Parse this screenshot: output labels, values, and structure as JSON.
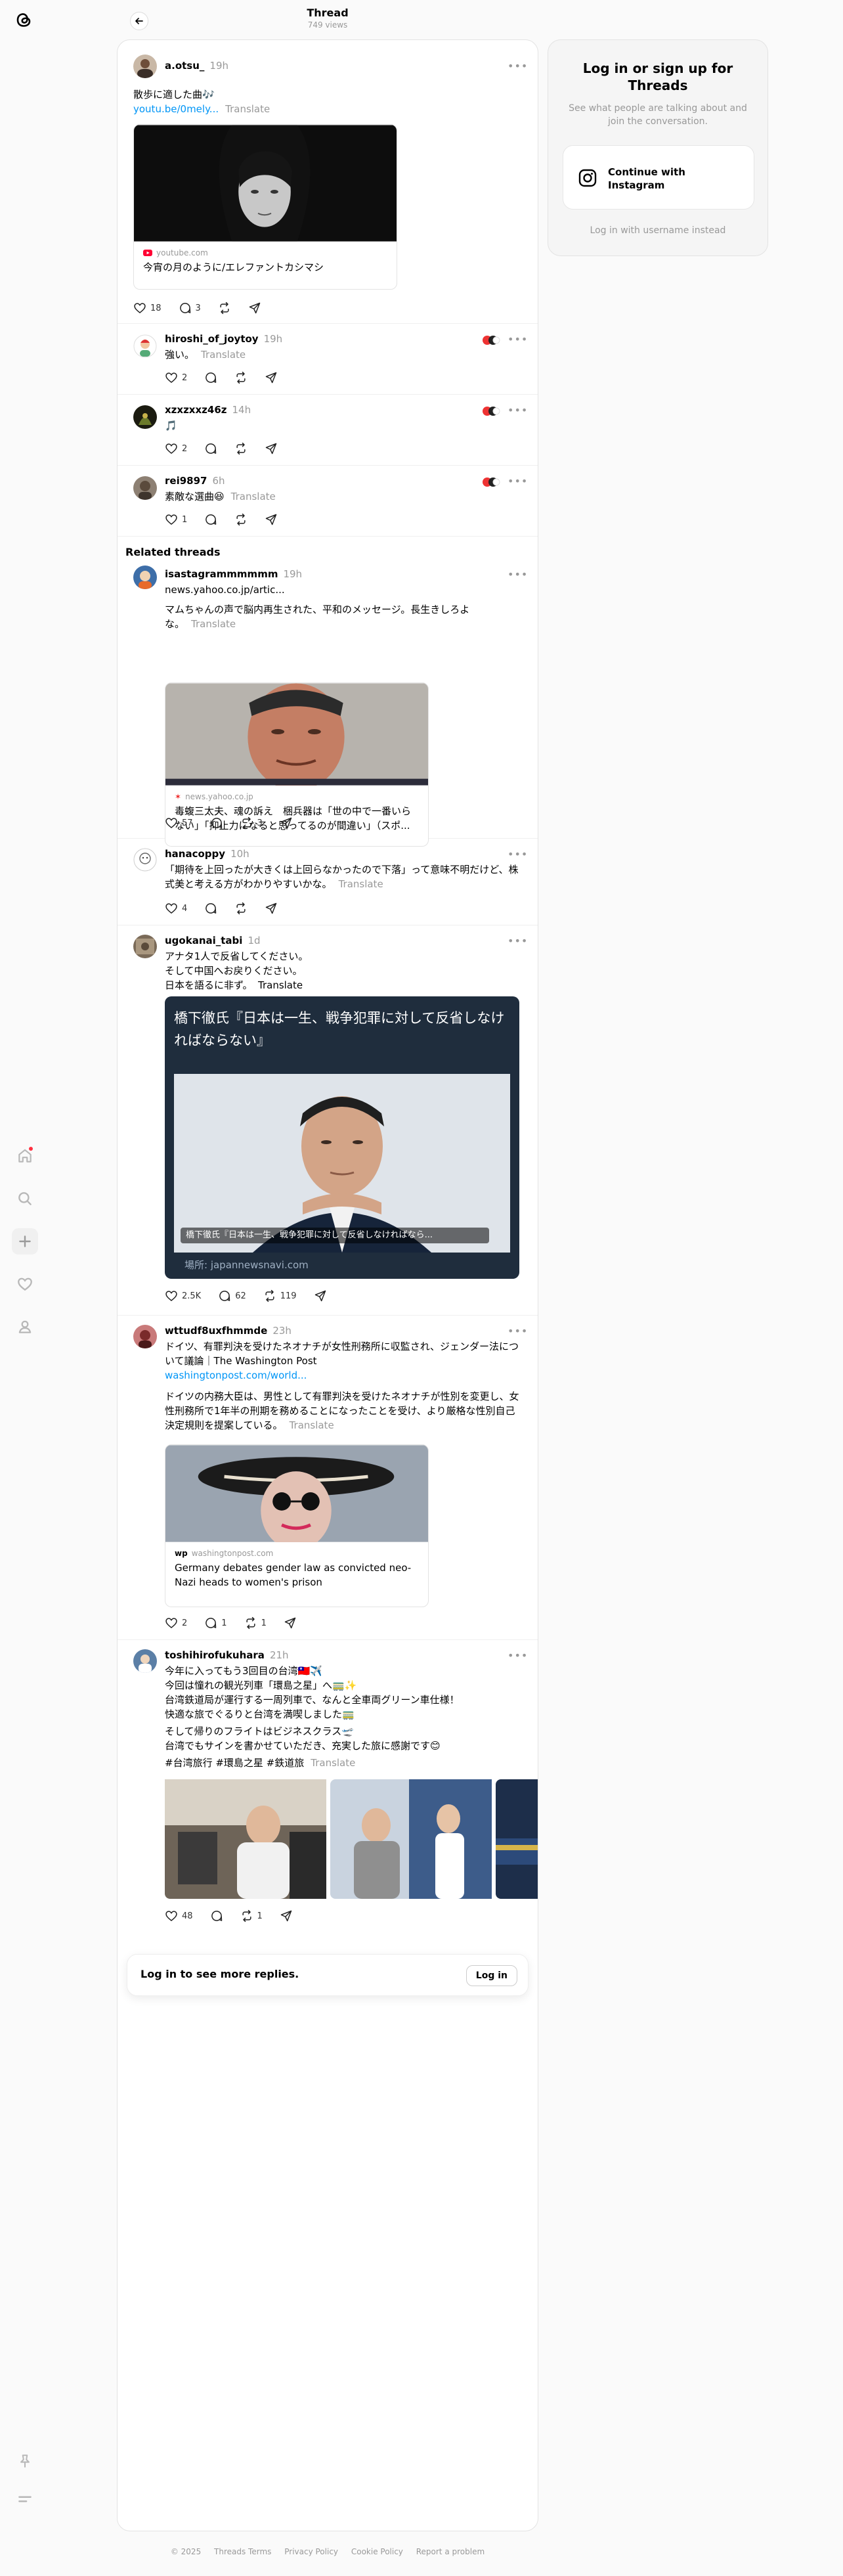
{
  "header": {
    "title": "Thread",
    "views": "749 views"
  },
  "rail": {
    "icons": [
      "threads-logo-icon",
      "home-icon",
      "search-icon",
      "plus-icon",
      "heart-icon",
      "profile-icon",
      "pin-icon",
      "menu-icon"
    ]
  },
  "main_post": {
    "username": "a.otsu_",
    "time": "19h",
    "text": "散歩に適した曲🎶",
    "link": "youtu.be/0mely...",
    "translate": "Translate",
    "card": {
      "source": "youtube.com",
      "title": "今宵の月のように/エレファントカシマシ"
    },
    "likes": "18",
    "replies": "3"
  },
  "replies": [
    {
      "username": "hiroshi_of_joytoy",
      "time": "19h",
      "text": "強い。",
      "translate": "Translate",
      "likes": "2"
    },
    {
      "username": "xzxzxxz46z",
      "time": "14h",
      "text": "🎵",
      "translate": "",
      "likes": "2"
    },
    {
      "username": "rei9897",
      "time": "6h",
      "text": "素敵な選曲😆",
      "translate": "Translate",
      "likes": "1"
    }
  ],
  "related": {
    "heading": "Related threads",
    "posts": [
      {
        "username": "isastagrammmmmm",
        "time": "19h",
        "link": "news.yahoo.co.jp/artic...",
        "text": "マムちゃんの声で脳内再生された、平和のメッセージ。長生きしろよな。",
        "translate": "Translate",
        "card": {
          "source": "news.yahoo.co.jp",
          "title": "毒蝮三太夫、魂の訴え　梱兵器は「世の中で一番いらない」「抑止力になると思ってるのが間違い」（スポ..."
        },
        "likes": "57",
        "reposts": "3"
      },
      {
        "username": "hanacoppy",
        "time": "10h",
        "text": "「期待を上回ったが大きくは上回らなかったので下落」って意味不明だけど、株式美と考える方がわかりやすいかな。",
        "translate": "Translate",
        "likes": "4"
      },
      {
        "username": "ugokanai_tabi",
        "time": "1d",
        "text": "アナタ1人で反省してください。\nそして中国へお戻りください。\n日本を語るに非ず。",
        "translate": "Translate",
        "card": {
          "headline": "橋下徹氏『日本は一生、戦争犯罪に対して反省しなければならない』",
          "caption": "橋下徹氏『日本は一生、戦争犯罪に対して反省しなければなら...",
          "place": "場所: japannewsnavi.com"
        },
        "likes": "2.5K",
        "replies": "62",
        "reposts": "119"
      },
      {
        "username": "wttudf8uxfhmmde",
        "time": "23h",
        "text": "ドイツ、有罪判決を受けたネオナチが女性刑務所に収監され、ジェンダー法について議論｜The Washington Post",
        "link": "washingtonpost.com/world...",
        "text2": "ドイツの内務大臣は、男性として有罪判決を受けたネオナチが性別を変更し、女性刑務所で1年半の刑期を務めることになったことを受け、より厳格な性別自己決定規則を提案している。",
        "translate": "Translate",
        "card": {
          "source": "washingtonpost.com",
          "title": "Germany debates gender law as convicted neo-Nazi heads to women's prison"
        },
        "likes": "2",
        "replies": "1",
        "reposts": "1"
      },
      {
        "username": "toshihirofukuhara",
        "time": "21h",
        "text": "今年に入ってもう3回目の台湾🇹🇼✈️\n今回は憧れの観光列車「環島之星」へ🚃✨\n台湾鉄道局が運行する一周列車で、なんと全車両グリーン車仕様！\n快適な旅でぐるりと台湾を満喫しました🚃",
        "text2": "そして帰りのフライトはビジネスクラス🛫\n台湾でもサインを書かせていただき、充実した旅に感謝です😊",
        "tags": "#台湾旅行 #環島之星 #鉄道旅",
        "translate": "Translate",
        "likes": "48",
        "reposts": "1"
      }
    ]
  },
  "login_bar": {
    "text": "Log in to see more replies.",
    "button": "Log in"
  },
  "side": {
    "title": "Log in or sign up for Threads",
    "subtitle": "See what people are talking about and join the conversation.",
    "instagram_button": "Continue with Instagram",
    "alt_login": "Log in with username instead"
  },
  "footer": [
    "© 2025",
    "Threads Terms",
    "Privacy Policy",
    "Cookie Policy",
    "Report a problem"
  ],
  "colors": {
    "link": "#0095f6",
    "accent_dot": "#ff3040",
    "muted": "#999999"
  }
}
